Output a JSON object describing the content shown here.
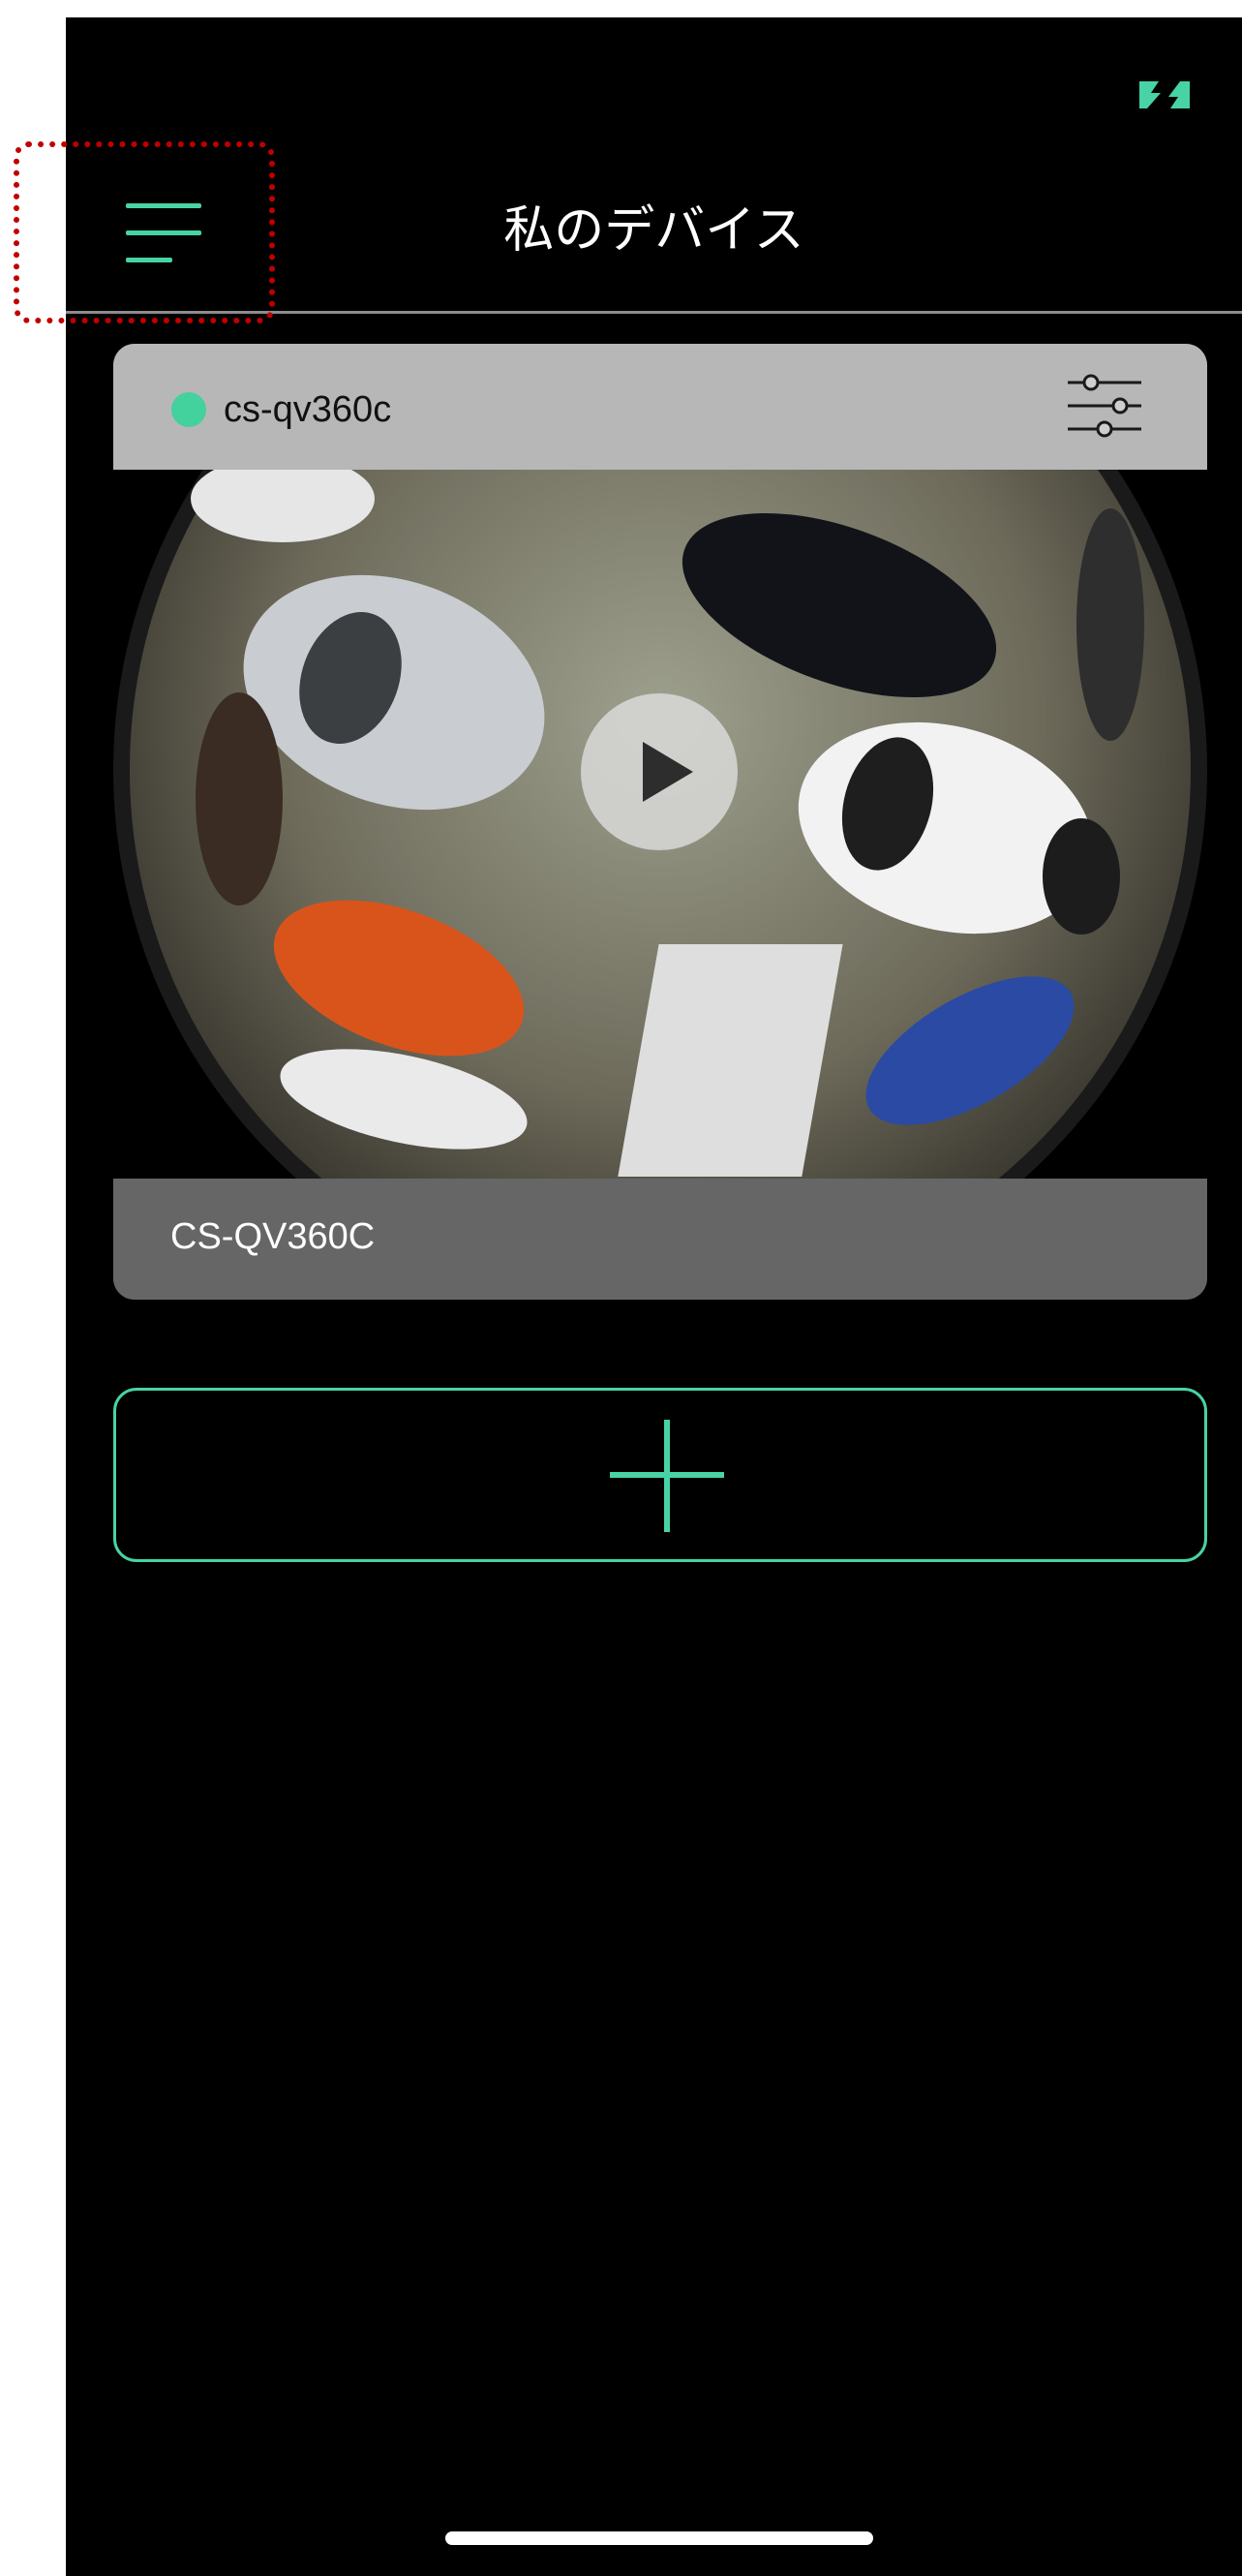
{
  "nav": {
    "title": "私のデバイス"
  },
  "status_bar": {
    "battery_icon": "battery-charging-icon",
    "accent": "#47d3a5"
  },
  "device": {
    "id_label": "cs-qv360c",
    "name_label": "CS-QV360C",
    "status_color": "#43d19e",
    "icons": {
      "settings": "sliders-icon",
      "play": "play-icon"
    }
  },
  "add_device": {
    "icon": "plus-icon"
  },
  "colors": {
    "background": "#000000",
    "accent": "#47d3a5",
    "highlight": "#c00000"
  }
}
